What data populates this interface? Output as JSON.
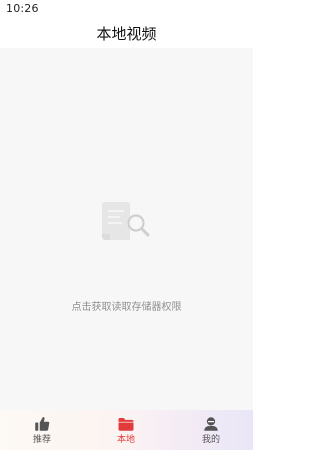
{
  "status_bar": {
    "time": "10:26"
  },
  "header": {
    "title": "本地视频"
  },
  "empty_state": {
    "icon": "document-search-icon",
    "message": "点击获取读取存储器权限"
  },
  "tabbar": {
    "active_color": "#e23b3b",
    "inactive_color": "#555555",
    "tabs": [
      {
        "label": "推荐",
        "icon": "thumbs-up-icon",
        "active": false
      },
      {
        "label": "本地",
        "icon": "folder-icon",
        "active": true
      },
      {
        "label": "我的",
        "icon": "user-icon",
        "active": false
      }
    ]
  }
}
